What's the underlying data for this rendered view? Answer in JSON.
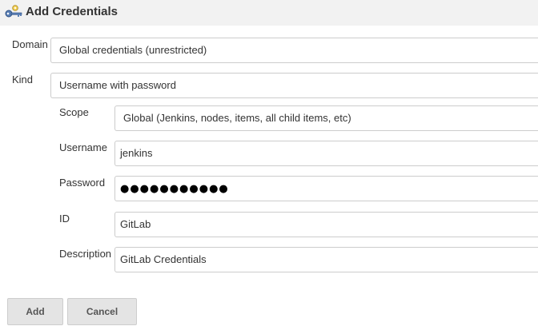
{
  "dialog": {
    "title": "Add Credentials",
    "title_icon": "keys-icon"
  },
  "form": {
    "domain": {
      "label": "Domain",
      "value": "Global credentials (unrestricted)"
    },
    "kind": {
      "label": "Kind",
      "value": "Username with password"
    },
    "scope": {
      "label": "Scope",
      "value": "Global (Jenkins, nodes, items, all child items, etc)"
    },
    "username": {
      "label": "Username",
      "value": "jenkins"
    },
    "password": {
      "label": "Password",
      "masked_value": "●●●●●●●●●●●"
    },
    "id": {
      "label": "ID",
      "value": "GitLab"
    },
    "description": {
      "label": "Description",
      "value": "GitLab Credentials"
    }
  },
  "buttons": {
    "add_label": "Add",
    "cancel_label": "Cancel"
  }
}
